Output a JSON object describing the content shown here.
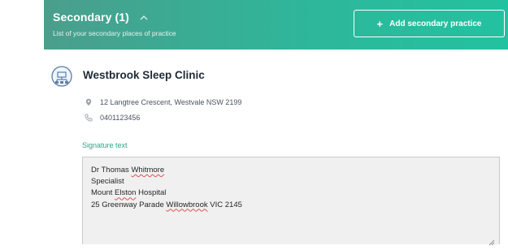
{
  "header": {
    "title": "Secondary (1)",
    "subtitle": "List of your secondary places of practice",
    "add_button_label": "Add secondary practice",
    "gradient_start": "#4a9e8c",
    "gradient_end": "#22c2a0"
  },
  "practice": {
    "icon": "building-network-icon",
    "name": "Westbrook Sleep Clinic",
    "address": "12 Langtree Crescent, Westvale NSW 2199",
    "phone": "0401123456"
  },
  "signature": {
    "label": "Signature text",
    "lines": [
      {
        "pre": "Dr Thomas ",
        "misspelled": "Whitmore",
        "post": ""
      },
      {
        "pre": "Specialist",
        "misspelled": "",
        "post": ""
      },
      {
        "pre": "Mount ",
        "misspelled": "Elston",
        "post": " Hospital"
      },
      {
        "pre": "25 Greenway Parade ",
        "misspelled": "Willowbrook",
        "post": " VIC 2145"
      }
    ]
  },
  "colors": {
    "accent": "#2ea387",
    "textarea_bg": "#f0f0f0"
  }
}
